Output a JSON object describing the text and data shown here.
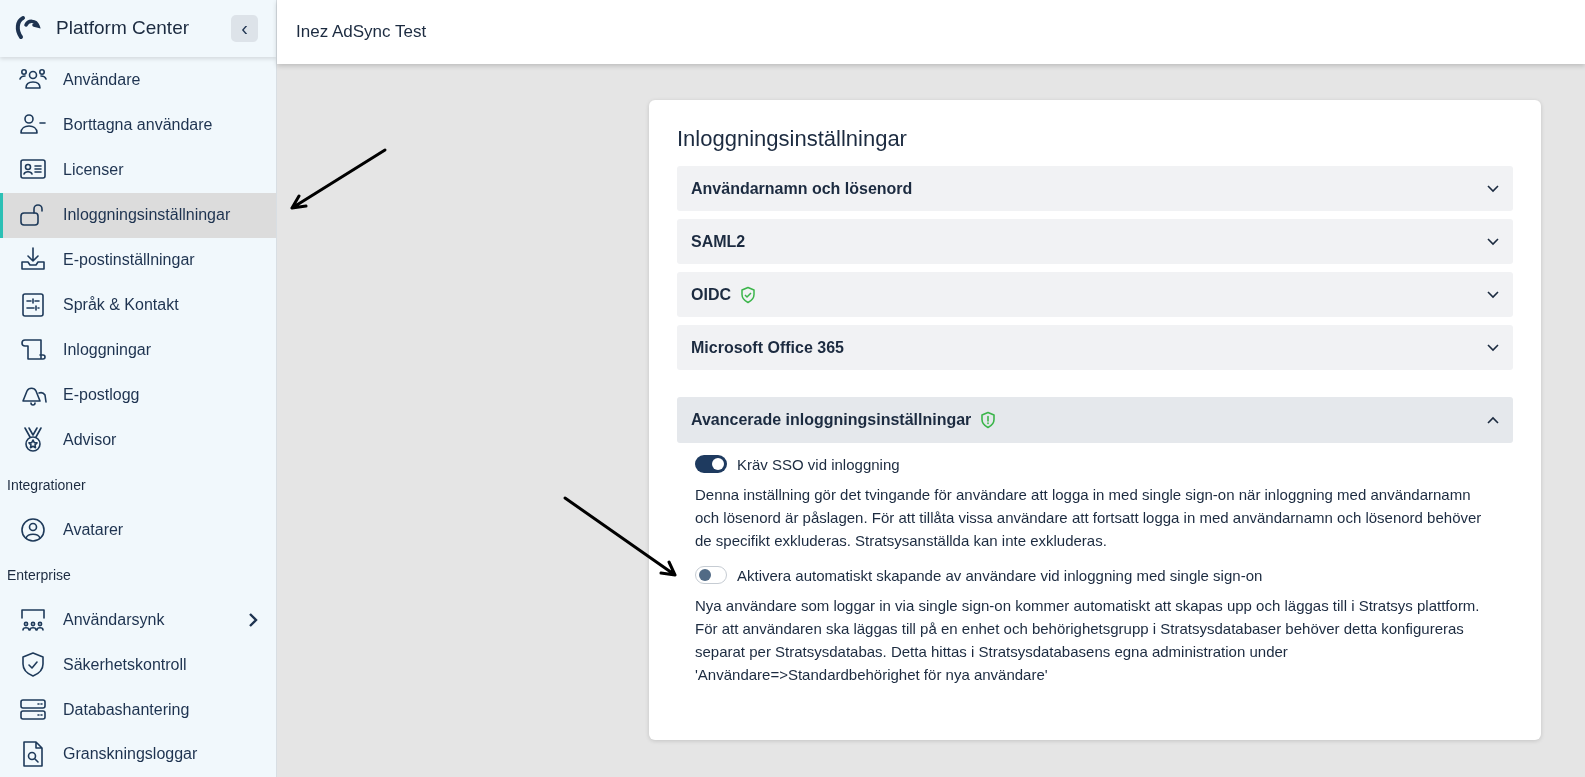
{
  "sidebar": {
    "title": "Platform Center",
    "collapse_button": "‹",
    "groups": [
      {
        "items": [
          {
            "label": "Användare",
            "selected": false
          },
          {
            "label": "Borttagna användare",
            "selected": false
          },
          {
            "label": "Licenser",
            "selected": false
          },
          {
            "label": "Inloggningsinställningar",
            "selected": true
          },
          {
            "label": "E-postinställningar",
            "selected": false
          },
          {
            "label": "Språk & Kontakt",
            "selected": false
          },
          {
            "label": "Inloggningar",
            "selected": false
          },
          {
            "label": "E-postlogg",
            "selected": false
          },
          {
            "label": "Advisor",
            "selected": false
          }
        ]
      },
      {
        "heading": "Integrationer",
        "items": [
          {
            "label": "Avatarer",
            "selected": false
          }
        ]
      },
      {
        "heading": "Enterprise",
        "items": [
          {
            "label": "Användarsynk",
            "selected": false,
            "submenu": true
          },
          {
            "label": "Säkerhetskontroll",
            "selected": false
          },
          {
            "label": "Databashantering",
            "selected": false
          },
          {
            "label": "Granskningsloggar",
            "selected": false
          }
        ]
      }
    ]
  },
  "header": {
    "title": "Inez AdSync Test"
  },
  "card": {
    "title": "Inloggningsinställningar",
    "sections": [
      {
        "label": "Användarnamn och lösenord",
        "expanded": false
      },
      {
        "label": "SAML2",
        "expanded": false
      },
      {
        "label": "OIDC",
        "expanded": false,
        "verified": true
      },
      {
        "label": "Microsoft Office 365",
        "expanded": false
      }
    ],
    "advanced": {
      "label": "Avancerade inloggningsinställningar",
      "expanded": true,
      "needs_attention": true,
      "settings": [
        {
          "label": "Kräv SSO vid inloggning",
          "on": true,
          "description": "Denna inställning gör det tvingande för användare att logga in med single sign-on när inloggning med användarnamn och lösenord är påslagen. För att tillåta vissa användare att fortsatt logga in med användarnamn och lösenord behöver de specifikt exkluderas. Stratsysanställda kan inte exkluderas."
        },
        {
          "label": "Aktivera automatiskt skapande av användare vid inloggning med single sign-on",
          "on": false,
          "description": "Nya användare som loggar in via single sign-on kommer automatiskt att skapas upp och läggas till i Stratsys plattform. För att användaren ska läggas till på en enhet och behörighetsgrupp i Stratsysdatabaser behöver detta konfigureras separat per Stratsysdatabas. Detta hittas i Stratsysdatabasens egna administration under 'Användare=>Standardbehörighet för nya användare'"
        }
      ]
    }
  }
}
